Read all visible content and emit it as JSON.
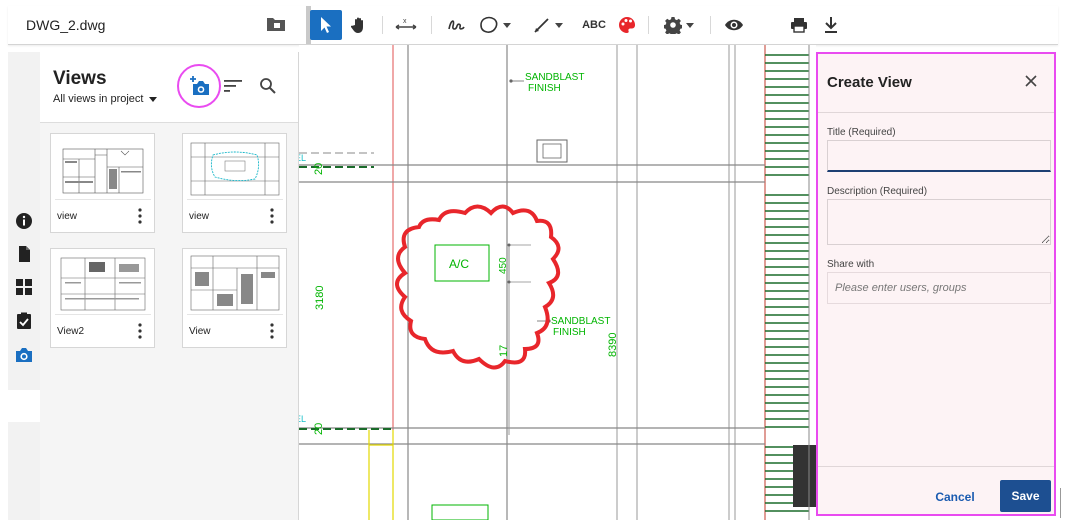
{
  "file": {
    "name": "DWG_2.dwg"
  },
  "toolbar": {
    "tools": [
      "select-tool",
      "pan-tool",
      "measure-tool",
      "freehand-tool",
      "cloud-shape-tool",
      "line-tool",
      "text-tool",
      "color-tool",
      "settings-tool",
      "view-tool",
      "print-tool",
      "download-tool"
    ],
    "text_tool_label": "ABC"
  },
  "views_panel": {
    "title": "Views",
    "filter_label": "All views in project",
    "cards": [
      {
        "label": "view"
      },
      {
        "label": "view"
      },
      {
        "label": "View2"
      },
      {
        "label": "View"
      }
    ]
  },
  "drawing": {
    "labels": {
      "sandblast_top_1": "SANDBLAST",
      "sandblast_top_2": "FINISH",
      "sandblast_mid_1": "SANDBLAST",
      "sandblast_mid_2": "FINISH",
      "ac": "A/C",
      "dim_450": "450",
      "dim_3180": "3180",
      "dim_8390": "8390",
      "dim_20a": "20",
      "dim_20b": "20",
      "dim_17": "17",
      "el_a": "EL",
      "el_b": "EL"
    },
    "colors": {
      "markup": "#e8262b",
      "cad_text": "#00b400"
    }
  },
  "create_view": {
    "title": "Create View",
    "title_label": "Title (Required)",
    "title_value": "",
    "description_label": "Description (Required)",
    "description_value": "",
    "share_label": "Share with",
    "share_placeholder": "Please enter users, groups",
    "cancel_label": "Cancel",
    "save_label": "Save"
  },
  "colors": {
    "accent": "#1a6fc1",
    "save": "#1d4f91",
    "highlight": "#e94bf0"
  }
}
